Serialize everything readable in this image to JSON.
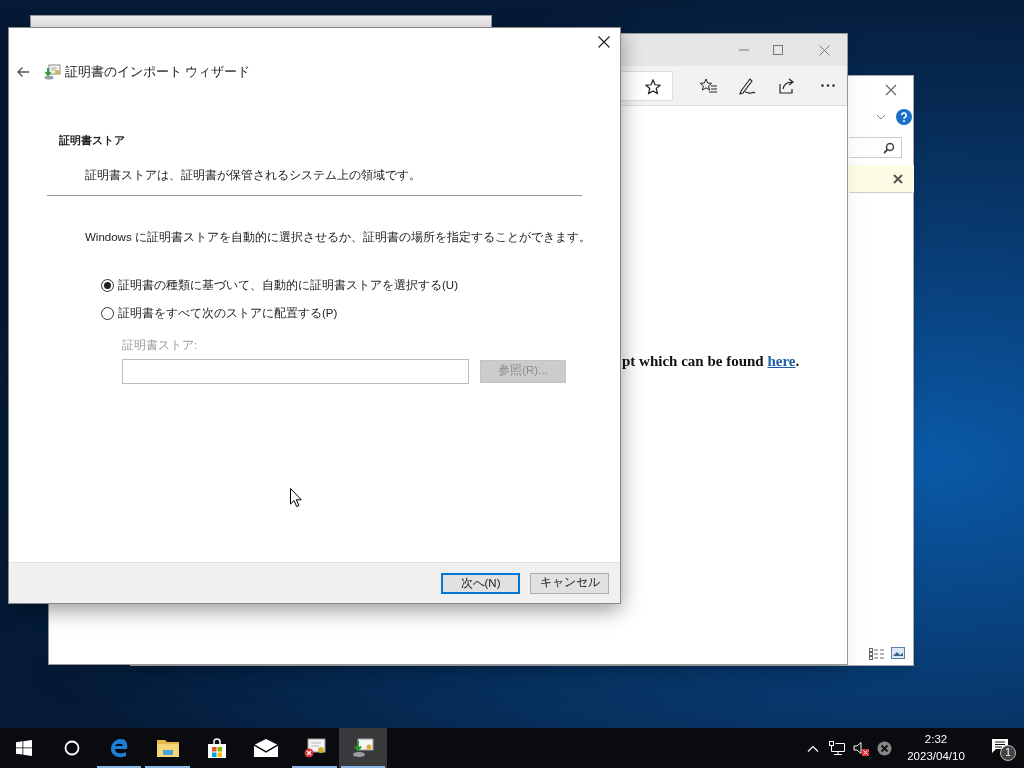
{
  "wizard": {
    "title": "証明書のインポート ウィザード",
    "section_title": "証明書ストア",
    "section_description": "証明書ストアは、証明書が保管されるシステム上の領域です。",
    "intro": "Windows に証明書ストアを自動的に選択させるか、証明書の場所を指定することができます。",
    "options": [
      {
        "label": "証明書の種類に基づいて、自動的に証明書ストアを選択する(U)",
        "selected": true
      },
      {
        "label": "証明書をすべて次のストアに配置する(P)",
        "selected": false
      }
    ],
    "store": {
      "label": "証明書ストア:",
      "disabled": true
    },
    "browse_button": {
      "label": "参照(R)...",
      "disabled": true
    },
    "buttons": [
      {
        "label": "次へ(N)",
        "default": true
      },
      {
        "label": "キャンセル",
        "default": false
      }
    ]
  },
  "browser": {
    "text_before": "pt which can be found ",
    "link": "here",
    "text_after": "."
  },
  "taskbar": {
    "apps": [
      {
        "kind": "start",
        "running": false,
        "selected": false
      },
      {
        "kind": "search",
        "running": false,
        "selected": false
      },
      {
        "kind": "edge",
        "running": true,
        "selected": false
      },
      {
        "kind": "explorer",
        "running": true,
        "selected": false
      },
      {
        "kind": "store",
        "running": false,
        "selected": false
      },
      {
        "kind": "mail",
        "running": false,
        "selected": false
      },
      {
        "kind": "certificate",
        "running": true,
        "selected": false
      },
      {
        "kind": "wizard",
        "running": true,
        "selected": true
      }
    ],
    "time": "2:32",
    "date": "2023/04/10",
    "notification_count": "1"
  }
}
